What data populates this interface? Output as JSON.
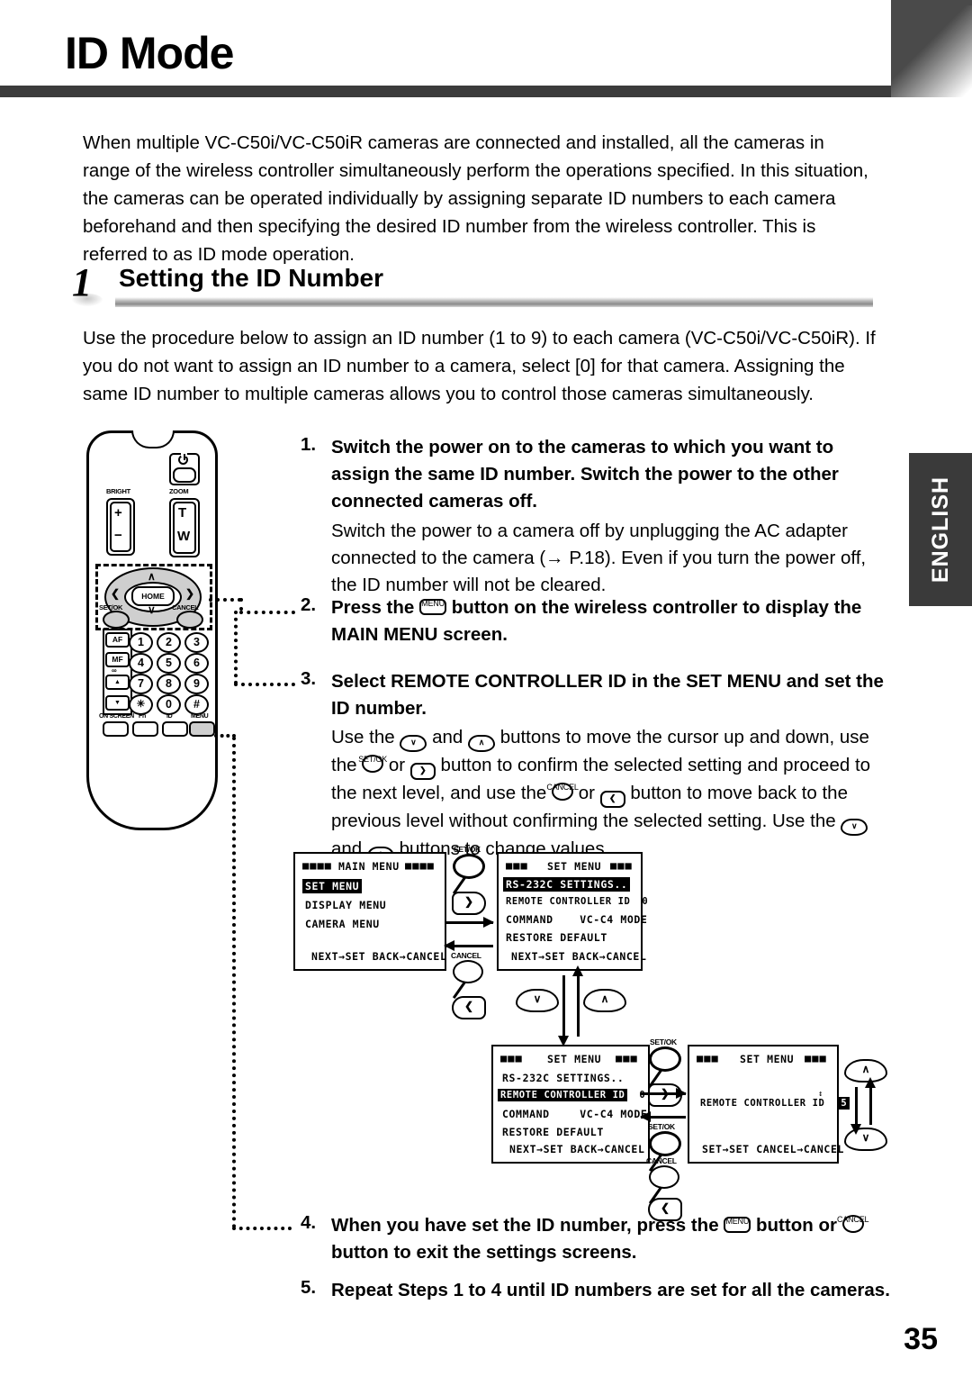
{
  "header": {
    "title": "ID Mode",
    "language_tab": "ENGLISH"
  },
  "intro_paragraph": "When multiple VC-C50i/VC-C50iR cameras are connected and installed, all the cameras in range of the wireless controller simultaneously perform the operations specified. In this situation, the cameras can be operated individually by assigning separate ID numbers to each camera beforehand and then specifying the desired ID number from the wireless controller. This is referred to as ID mode operation.",
  "section": {
    "number": "1",
    "title": "Setting the ID Number",
    "body": "Use the procedure below to assign an ID number (1 to 9) to each camera (VC-C50i/VC-C50iR). If you do not want to assign an ID number to a camera, select [0] for that camera. Assigning the same ID number to multiple cameras allows you to control those cameras simultaneously."
  },
  "steps": [
    {
      "number": "1.",
      "heading": "Switch the power on to the cameras to which you want to assign the same ID number. Switch the power to the other connected cameras off.",
      "body": "Switch the power to a camera off by unplugging the AC adapter connected to the camera (→ P.18). Even if you turn the power off, the ID number will not be cleared."
    },
    {
      "number": "2.",
      "heading_part1": "Press the",
      "heading_part2": "button on the wireless controller to display the MAIN MENU screen.",
      "glyph": "MENU"
    },
    {
      "number": "3.",
      "heading": "Select REMOTE CONTROLLER ID in the SET MENU and set the ID number.",
      "body_1": "Use the",
      "body_2": "and",
      "body_3": "buttons to move the cursor up and down, use the",
      "body_4": "or",
      "body_5": "button to confirm the selected setting and proceed to the next level, and use the",
      "body_6": "or",
      "body_7": "button to move back to the previous level without confirming the selected setting. Use the",
      "body_8": "and",
      "body_9": "buttons to change values."
    },
    {
      "number": "4.",
      "heading_part1": "When you have set the ID number, press the",
      "heading_part2": "button or",
      "heading_part3": "button to exit the settings screens."
    },
    {
      "number": "5.",
      "heading": "Repeat Steps 1 to 4 until ID numbers are set for all the cameras."
    }
  ],
  "remote": {
    "labels": {
      "bright": "BRIGHT",
      "zoom": "ZOOM",
      "bright_plus": "+",
      "bright_minus": "−",
      "zoom_t": "T",
      "zoom_w": "W",
      "home": "HOME",
      "setok": "SET/OK",
      "cancel": "CANCEL",
      "af": "AF",
      "mf": "MF",
      "focus_far": "▲",
      "focus_near": "▼",
      "infinity": "∞",
      "on_screen": "ON SCREEN",
      "fn": "Fn",
      "id": "ID",
      "menu": "MENU"
    },
    "keypad": [
      "1",
      "2",
      "3",
      "4",
      "5",
      "6",
      "7",
      "8",
      "9",
      "✳",
      "0",
      "#"
    ]
  },
  "osd_screens": [
    {
      "id": "main-menu",
      "title": "MAIN  MENU",
      "blocks_left": "■■■■",
      "blocks_right": "■■■■",
      "rows": [
        {
          "label": "SET MENU",
          "value": "",
          "highlight": true
        },
        {
          "label": "DISPLAY MENU",
          "value": "",
          "highlight": false
        },
        {
          "label": "CAMERA MENU",
          "value": "",
          "highlight": false
        }
      ],
      "footer": "NEXT→SET  BACK→CANCEL"
    },
    {
      "id": "set-menu-rs232c",
      "title": "SET MENU",
      "blocks_left": "■■■",
      "blocks_right": "■■■",
      "rows": [
        {
          "label": "RS-232C SETTINGS..",
          "value": "",
          "highlight": true
        },
        {
          "label": "REMOTE CONTROLLER ID",
          "value": "0",
          "highlight": false
        },
        {
          "label": "COMMAND",
          "value": "VC-C4 MODE",
          "highlight": false
        },
        {
          "label": "RESTORE DEFAULT",
          "value": "",
          "highlight": false
        }
      ],
      "footer": "NEXT→SET  BACK→CANCEL"
    },
    {
      "id": "set-menu-rcid",
      "title": "SET MENU",
      "blocks_left": "■■■",
      "blocks_right": "■■■",
      "rows": [
        {
          "label": "RS-232C SETTINGS..",
          "value": "",
          "highlight": false
        },
        {
          "label": "REMOTE CONTROLLER ID",
          "value": "0",
          "highlight": true
        },
        {
          "label": "COMMAND",
          "value": "VC-C4 MODE",
          "highlight": false
        },
        {
          "label": "RESTORE DEFAULT",
          "value": "",
          "highlight": false
        }
      ],
      "footer": "NEXT→SET  BACK→CANCEL"
    },
    {
      "id": "set-menu-rcid-edit",
      "title": "SET MENU",
      "blocks_left": "■■■",
      "blocks_right": "■■■",
      "rows": [
        {
          "label": "REMOTE CONTROLLER ID",
          "value": "5",
          "highlight": false
        }
      ],
      "footer": "SET→SET CANCEL→CANCEL"
    }
  ],
  "diagram_buttons": {
    "setok": "SET/OK",
    "cancel": "CANCEL",
    "right_chevron": "❯",
    "left_chevron": "❮",
    "up_chevron": "∧",
    "down_chevron": "∨"
  },
  "page_number": "35"
}
